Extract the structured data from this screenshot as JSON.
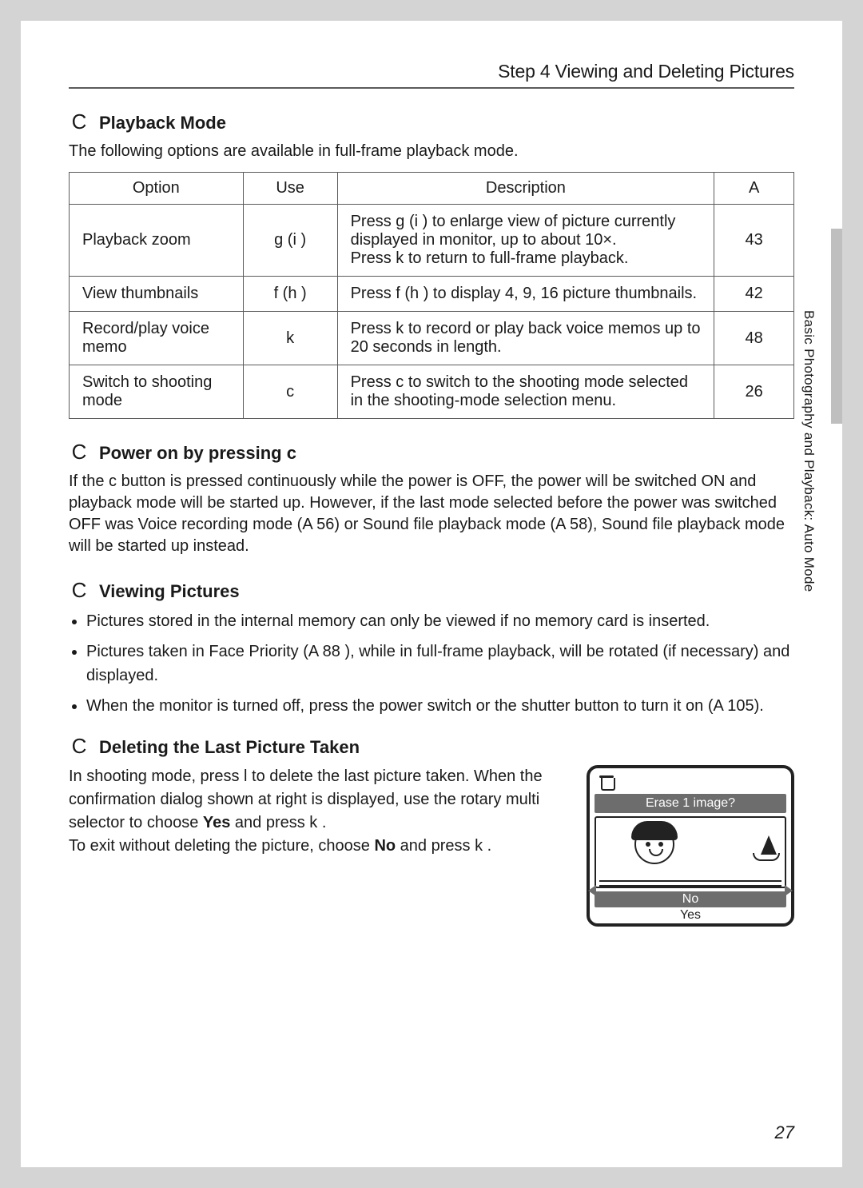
{
  "header": "Step 4 Viewing and Deleting Pictures",
  "side_label": "Basic Photography and Playback: Auto Mode",
  "page_number": "27",
  "thumb_tab_visible": true,
  "sec1": {
    "symbol": "C",
    "title": "Playback Mode",
    "intro": "The following options are available in full-frame playback mode.",
    "table": {
      "headers": {
        "option": "Option",
        "use": "Use",
        "desc": "Description",
        "page": "A"
      },
      "rows": [
        {
          "option": "Playback zoom",
          "use": "g (i )",
          "desc": "Press g (i ) to enlarge view of picture currently displayed in monitor, up to about 10×.\nPress k  to return to full-frame playback.",
          "page": "43"
        },
        {
          "option": "View thumbnails",
          "use": "f   (h  )",
          "desc": "Press f   (h  ) to display 4, 9, 16 picture thumbnails.",
          "page": "42"
        },
        {
          "option": "Record/play voice memo",
          "use": "k",
          "desc": "Press k  to record or play back voice memos up to 20 seconds in length.",
          "page": "48"
        },
        {
          "option": "Switch to shooting mode",
          "use": "c",
          "desc": "Press c  to switch to the shooting mode selected in the shooting-mode selection menu.",
          "page": "26"
        }
      ]
    }
  },
  "sec2": {
    "symbol": "C",
    "title": "Power on by pressing c",
    "body": "If the c  button is pressed continuously while the power is OFF, the power will be switched ON and playback mode will be started up. However, if the last mode selected before the power was switched OFF was Voice recording mode (A 56) or Sound file playback mode (A 58), Sound file playback mode will be started up instead."
  },
  "sec3": {
    "symbol": "C",
    "title": "Viewing Pictures",
    "bullets": [
      "Pictures stored in the internal memory can only be viewed if no memory card is inserted.",
      "Pictures taken in Face Priority (A 88 ), while in full-frame playback, will be rotated (if necessary) and displayed.",
      "When the monitor is turned off, press the power switch or the shutter button to turn it on (A 105)."
    ]
  },
  "sec4": {
    "symbol": "C",
    "title": "Deleting the Last Picture Taken",
    "para1_pre": "In shooting mode, press l  to delete the last picture taken. When the confirmation dialog shown at right is displayed, use the rotary multi selector to choose ",
    "para1_bold1": "Yes",
    "para1_mid": " and press k .",
    "para2_pre": "To exit without deleting the picture, choose ",
    "para2_bold1": "No",
    "para2_post": " and press k .",
    "dialog": {
      "title": "Erase 1 image?",
      "opt_no": "No",
      "opt_yes": "Yes"
    }
  }
}
